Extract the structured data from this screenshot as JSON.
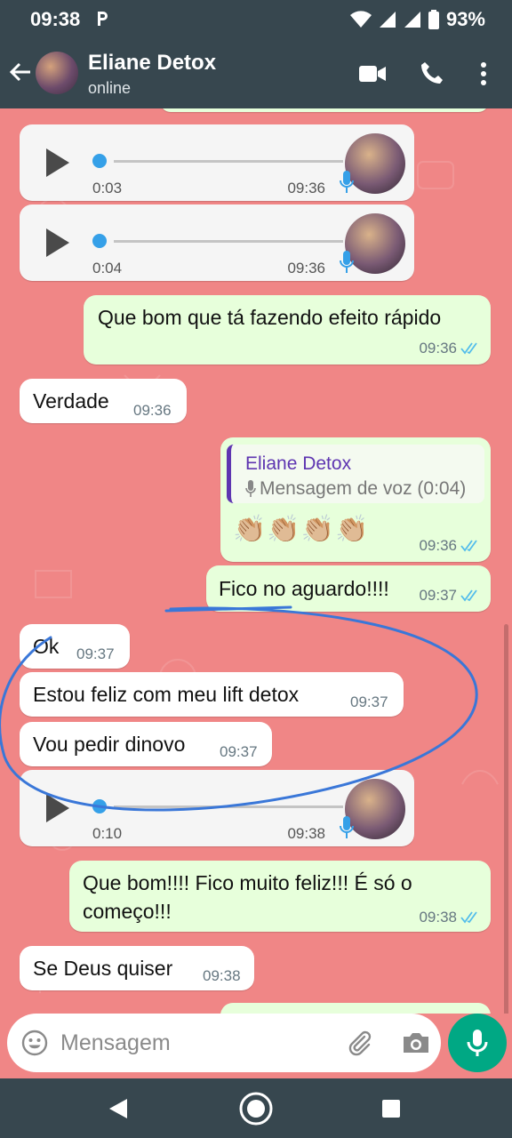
{
  "status_bar": {
    "time": "09:38",
    "battery": "93%"
  },
  "header": {
    "name": "Eliane Detox",
    "status": "online"
  },
  "messages": {
    "voice1": {
      "duration": "0:03",
      "time": "09:36"
    },
    "voice2": {
      "duration": "0:04",
      "time": "09:36"
    },
    "m1": {
      "text": "Que bom que tá fazendo efeito rápido",
      "time": "09:36"
    },
    "m2": {
      "text": "Verdade",
      "time": "09:36"
    },
    "reply": {
      "quote_name": "Eliane Detox",
      "quote_text": "Mensagem de voz (0:04)",
      "emojis": "👏🏼👏🏼👏🏼👏🏼",
      "time": "09:36"
    },
    "m3": {
      "text": "Fico no aguardo!!!!",
      "time": "09:37"
    },
    "m4": {
      "text": "Ok",
      "time": "09:37"
    },
    "m5": {
      "text": "Estou feliz com meu lift detox",
      "time": "09:37"
    },
    "m6": {
      "text": "Vou pedir dinovo",
      "time": "09:37"
    },
    "voice3": {
      "duration": "0:10",
      "time": "09:38"
    },
    "m7": {
      "line1": "Que bom!!!! Fico muito feliz!!! É só o",
      "line2": "começo!!!",
      "time": "09:38"
    },
    "m8": {
      "text": "Se Deus quiser",
      "time": "09:38"
    }
  },
  "input": {
    "placeholder": "Mensagem"
  },
  "colors": {
    "header": "#37474f",
    "outgoing": "#e7ffdb",
    "incoming": "#ffffff",
    "accent": "#00a884",
    "chat_bg": "#f08686",
    "annotation": "#3a77d8"
  }
}
